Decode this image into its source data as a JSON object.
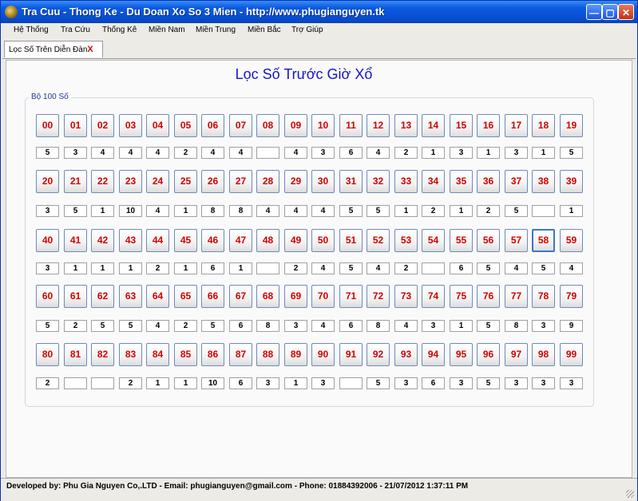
{
  "window": {
    "title": "Tra Cuu - Thong Ke - Du Doan Xo So 3 Mien - http://www.phugianguyen.tk"
  },
  "menu": [
    "Hệ Thống",
    "Tra Cứu",
    "Thống Kê",
    "Miền Nam",
    "Miền Trung",
    "Miền Bắc",
    "Trợ Giúp"
  ],
  "tab": {
    "label": "Lọc Số Trên Diễn Đàn",
    "close": "X"
  },
  "page_title": "Lọc Số Trước Giờ Xổ",
  "group_label": "Bộ 100 Số",
  "selected_number": "58",
  "numbers": [
    [
      "00",
      "01",
      "02",
      "03",
      "04",
      "05",
      "06",
      "07",
      "08",
      "09",
      "10",
      "11",
      "12",
      "13",
      "14",
      "15",
      "16",
      "17",
      "18",
      "19"
    ],
    [
      "20",
      "21",
      "22",
      "23",
      "24",
      "25",
      "26",
      "27",
      "28",
      "29",
      "30",
      "31",
      "32",
      "33",
      "34",
      "35",
      "36",
      "37",
      "38",
      "39"
    ],
    [
      "40",
      "41",
      "42",
      "43",
      "44",
      "45",
      "46",
      "47",
      "48",
      "49",
      "50",
      "51",
      "52",
      "53",
      "54",
      "55",
      "56",
      "57",
      "58",
      "59"
    ],
    [
      "60",
      "61",
      "62",
      "63",
      "64",
      "65",
      "66",
      "67",
      "68",
      "69",
      "70",
      "71",
      "72",
      "73",
      "74",
      "75",
      "76",
      "77",
      "78",
      "79"
    ],
    [
      "80",
      "81",
      "82",
      "83",
      "84",
      "85",
      "86",
      "87",
      "88",
      "89",
      "90",
      "91",
      "92",
      "93",
      "94",
      "95",
      "96",
      "97",
      "98",
      "99"
    ]
  ],
  "counts": [
    [
      "5",
      "3",
      "4",
      "4",
      "4",
      "2",
      "4",
      "4",
      "",
      "4",
      "3",
      "6",
      "4",
      "2",
      "1",
      "3",
      "1",
      "3",
      "1",
      "5"
    ],
    [
      "3",
      "5",
      "1",
      "10",
      "4",
      "1",
      "8",
      "8",
      "4",
      "4",
      "4",
      "5",
      "5",
      "1",
      "2",
      "1",
      "2",
      "5",
      "",
      "1"
    ],
    [
      "3",
      "1",
      "1",
      "1",
      "2",
      "1",
      "6",
      "1",
      "",
      "2",
      "4",
      "5",
      "4",
      "2",
      "",
      "6",
      "5",
      "4",
      "5",
      "4"
    ],
    [
      "5",
      "2",
      "5",
      "5",
      "4",
      "2",
      "5",
      "6",
      "8",
      "3",
      "4",
      "6",
      "8",
      "4",
      "3",
      "1",
      "5",
      "8",
      "3",
      "9"
    ],
    [
      "2",
      "",
      "",
      "2",
      "1",
      "1",
      "10",
      "6",
      "3",
      "1",
      "3",
      "",
      "5",
      "3",
      "6",
      "3",
      "5",
      "3",
      "3",
      "3"
    ]
  ],
  "status": "Developed by: Phu Gia Nguyen Co,.LTD - Email: phugianguyen@gmail.com - Phone: 01884392006 - 21/07/2012 1:37:11 PM"
}
